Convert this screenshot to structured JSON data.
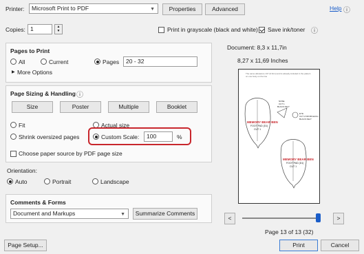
{
  "printer": {
    "label": "Printer:",
    "value": "Microsoft Print to PDF",
    "properties_label": "Properties",
    "advanced_label": "Advanced",
    "help_label": "Help",
    "help_glyph": "ⓘ"
  },
  "copies": {
    "label": "Copies:",
    "value": "1"
  },
  "options": {
    "grayscale_label": "Print in grayscale (black and white)",
    "grayscale_checked": false,
    "save_ink_label": "Save ink/toner",
    "save_ink_checked": true
  },
  "pages_to_print": {
    "title": "Pages to Print",
    "all_label": "All",
    "current_label": "Current",
    "pages_label": "Pages",
    "pages_value": "20 - 32",
    "selected": "pages",
    "more_options_label": "More Options"
  },
  "page_sizing": {
    "title": "Page Sizing & Handling",
    "tabs": [
      {
        "label": "Size"
      },
      {
        "label": "Poster"
      },
      {
        "label": "Multiple"
      },
      {
        "label": "Booklet"
      }
    ],
    "fit_label": "Fit",
    "actual_size_label": "Actual size",
    "shrink_label": "Shrink oversized pages",
    "custom_scale_label": "Custom Scale:",
    "custom_scale_value": "100",
    "percent_label": "%",
    "selected": "custom_scale",
    "paper_source_label": "Choose paper source by PDF page size",
    "highlight_color": "#c8262c"
  },
  "orientation": {
    "title": "Orientation:",
    "auto_label": "Auto",
    "portrait_label": "Portrait",
    "landscape_label": "Landscape",
    "selected": "auto"
  },
  "comments_forms": {
    "title": "Comments & Forms",
    "select_value": "Document and Markups",
    "summarize_label": "Summarize Comments"
  },
  "preview": {
    "document_label": "Document: 8,3 x 11,7in",
    "size_label": "8,27 x 11,69 Inches",
    "page_label": "Page 13 of 13 (32)",
    "prev_glyph": "<",
    "next_glyph": ">",
    "slider_fraction": 1.0
  },
  "pattern": {
    "fine_text": "The same allowance 1/4\" (0.6cm) and is already included in the pattern",
    "fine_text_2": "on one body on the line",
    "piece1_title": "MEMORY BEAR BEN",
    "piece1_sub": "FOOT PAD (D1)",
    "piece1_cut": "CUT 1",
    "piece2_title": "MEMORY BEAR BEN",
    "piece2_sub": "FOOT PAD (D1)",
    "piece2_cut": "CUT 1",
    "nose_label": "NOSE",
    "nose_cut": "CUT 1",
    "nose_color": "BLACK FELT",
    "eye_label": "EYE",
    "eye_cut": "CUT 2 FROM EACH",
    "eye_color": "BLACK FELT",
    "accent_color": "#c8262c"
  },
  "footer": {
    "page_setup_label": "Page Setup...",
    "print_label": "Print",
    "cancel_label": "Cancel"
  }
}
